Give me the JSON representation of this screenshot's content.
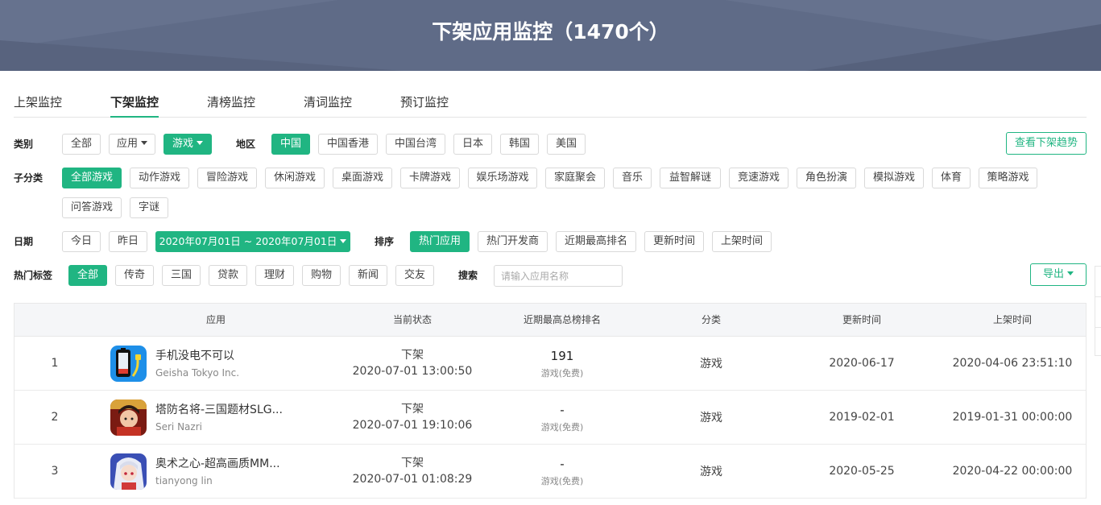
{
  "header": {
    "title": "下架应用监控（1470个）"
  },
  "tabs": [
    {
      "label": "上架监控",
      "active": false
    },
    {
      "label": "下架监控",
      "active": true
    },
    {
      "label": "清榜监控",
      "active": false
    },
    {
      "label": "清词监控",
      "active": false
    },
    {
      "label": "预订监控",
      "active": false
    }
  ],
  "filters": {
    "category": {
      "label": "类别",
      "options": [
        {
          "label": "全部",
          "selected": false
        },
        {
          "label": "应用",
          "selected": false,
          "dropdown": true
        },
        {
          "label": "游戏",
          "selected": true,
          "dropdown": true
        }
      ]
    },
    "region": {
      "label": "地区",
      "options": [
        {
          "label": "中国",
          "selected": true
        },
        {
          "label": "中国香港",
          "selected": false
        },
        {
          "label": "中国台湾",
          "selected": false
        },
        {
          "label": "日本",
          "selected": false
        },
        {
          "label": "韩国",
          "selected": false
        },
        {
          "label": "美国",
          "selected": false
        }
      ]
    },
    "trend_button": "查看下架趋势",
    "subcategory": {
      "label": "子分类",
      "options": [
        {
          "label": "全部游戏",
          "selected": true
        },
        {
          "label": "动作游戏",
          "selected": false
        },
        {
          "label": "冒险游戏",
          "selected": false
        },
        {
          "label": "休闲游戏",
          "selected": false
        },
        {
          "label": "桌面游戏",
          "selected": false
        },
        {
          "label": "卡牌游戏",
          "selected": false
        },
        {
          "label": "娱乐场游戏",
          "selected": false
        },
        {
          "label": "家庭聚会",
          "selected": false
        },
        {
          "label": "音乐",
          "selected": false
        },
        {
          "label": "益智解谜",
          "selected": false
        },
        {
          "label": "竞速游戏",
          "selected": false
        },
        {
          "label": "角色扮演",
          "selected": false
        },
        {
          "label": "模拟游戏",
          "selected": false
        },
        {
          "label": "体育",
          "selected": false
        },
        {
          "label": "策略游戏",
          "selected": false
        },
        {
          "label": "问答游戏",
          "selected": false
        },
        {
          "label": "字谜",
          "selected": false
        }
      ]
    },
    "date": {
      "label": "日期",
      "options": [
        {
          "label": "今日",
          "selected": false
        },
        {
          "label": "昨日",
          "selected": false
        },
        {
          "label": "2020年07月01日 ~ 2020年07月01日",
          "selected": true,
          "dropdown": true
        }
      ]
    },
    "sort": {
      "label": "排序",
      "options": [
        {
          "label": "热门应用",
          "selected": true
        },
        {
          "label": "热门开发商",
          "selected": false
        },
        {
          "label": "近期最高排名",
          "selected": false
        },
        {
          "label": "更新时间",
          "selected": false
        },
        {
          "label": "上架时间",
          "selected": false
        }
      ]
    },
    "tags": {
      "label": "热门标签",
      "options": [
        {
          "label": "全部",
          "selected": true
        },
        {
          "label": "传奇",
          "selected": false
        },
        {
          "label": "三国",
          "selected": false
        },
        {
          "label": "贷款",
          "selected": false
        },
        {
          "label": "理财",
          "selected": false
        },
        {
          "label": "购物",
          "selected": false
        },
        {
          "label": "新闻",
          "selected": false
        },
        {
          "label": "交友",
          "selected": false
        }
      ]
    },
    "search": {
      "label": "搜索",
      "placeholder": "请输入应用名称",
      "value": ""
    },
    "export_button": "导出"
  },
  "table": {
    "columns": [
      "应用",
      "当前状态",
      "近期最高总榜排名",
      "分类",
      "更新时间",
      "上架时间"
    ],
    "rows": [
      {
        "index": "1",
        "name": "手机没电不可以",
        "developer": "Geisha Tokyo Inc.",
        "icon": "battery-icon",
        "status": "下架",
        "status_time": "2020-07-01 13:00:50",
        "rank": "191",
        "rank_category": "游戏(免费)",
        "category": "游戏",
        "updated": "2020-06-17",
        "released": "2020-04-06 23:51:10"
      },
      {
        "index": "2",
        "name": "塔防名将-三国题材SLG...",
        "developer": "Seri Nazri",
        "icon": "warrior-game-icon",
        "status": "下架",
        "status_time": "2020-07-01 19:10:06",
        "rank": "-",
        "rank_category": "游戏(免费)",
        "category": "游戏",
        "updated": "2019-02-01",
        "released": "2019-01-31 00:00:00"
      },
      {
        "index": "3",
        "name": "奥术之心-超高画质MM...",
        "developer": "tianyong lin",
        "icon": "anime-girl-icon",
        "status": "下架",
        "status_time": "2020-07-01 01:08:29",
        "rank": "-",
        "rank_category": "游戏(免费)",
        "category": "游戏",
        "updated": "2020-05-25",
        "released": "2020-04-22 00:00:00"
      }
    ]
  },
  "colors": {
    "accent": "#20b582",
    "banner": "#5f6b87"
  }
}
